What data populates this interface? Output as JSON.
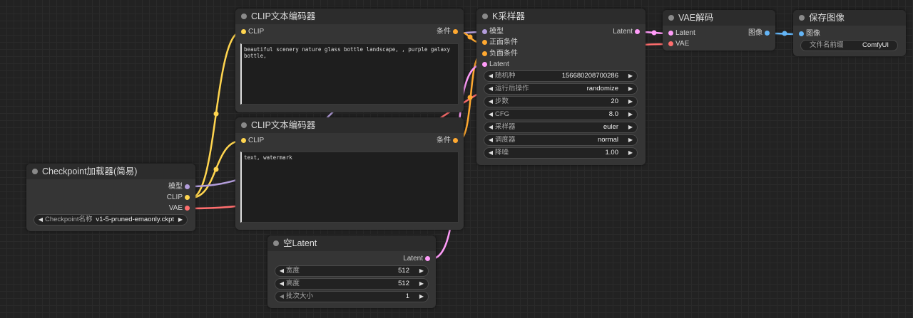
{
  "colors": {
    "model": "#b39ddb",
    "clip": "#ffd54f",
    "vae": "#ff6e6e",
    "conditioning": "#ffa931",
    "latent": "#ff9cf9",
    "image": "#64b5f6"
  },
  "nodes": {
    "checkpoint": {
      "title": "Checkpoint加载器(简易)",
      "outputs": [
        "模型",
        "CLIP",
        "VAE"
      ],
      "widget": {
        "label": "Checkpoint名称",
        "value": "v1-5-pruned-emaonly.ckpt"
      }
    },
    "clip_positive": {
      "title": "CLIP文本编码器",
      "input": "CLIP",
      "output": "条件",
      "text": "beautiful scenery nature glass bottle landscape, , purple galaxy bottle,"
    },
    "clip_negative": {
      "title": "CLIP文本编码器",
      "input": "CLIP",
      "output": "条件",
      "text": "text, watermark"
    },
    "empty_latent": {
      "title": "空Latent",
      "output": "Latent",
      "widgets": [
        {
          "label": "宽度",
          "value": "512"
        },
        {
          "label": "高度",
          "value": "512"
        },
        {
          "label": "批次大小",
          "value": "1"
        }
      ]
    },
    "ksampler": {
      "title": "K采样器",
      "inputs": [
        "模型",
        "正面条件",
        "负面条件",
        "Latent"
      ],
      "output": "Latent",
      "widgets": [
        {
          "label": "随机种",
          "value": "156680208700286"
        },
        {
          "label": "运行后操作",
          "value": "randomize"
        },
        {
          "label": "步数",
          "value": "20"
        },
        {
          "label": "CFG",
          "value": "8.0"
        },
        {
          "label": "采样器",
          "value": "euler"
        },
        {
          "label": "调度器",
          "value": "normal"
        },
        {
          "label": "降噪",
          "value": "1.00"
        }
      ]
    },
    "vae_decode": {
      "title": "VAE解码",
      "inputs": [
        "Latent",
        "VAE"
      ],
      "output": "图像"
    },
    "save_image": {
      "title": "保存图像",
      "input": "图像",
      "widget": {
        "label": "文件名前缀",
        "value": "ComfyUI"
      }
    }
  }
}
